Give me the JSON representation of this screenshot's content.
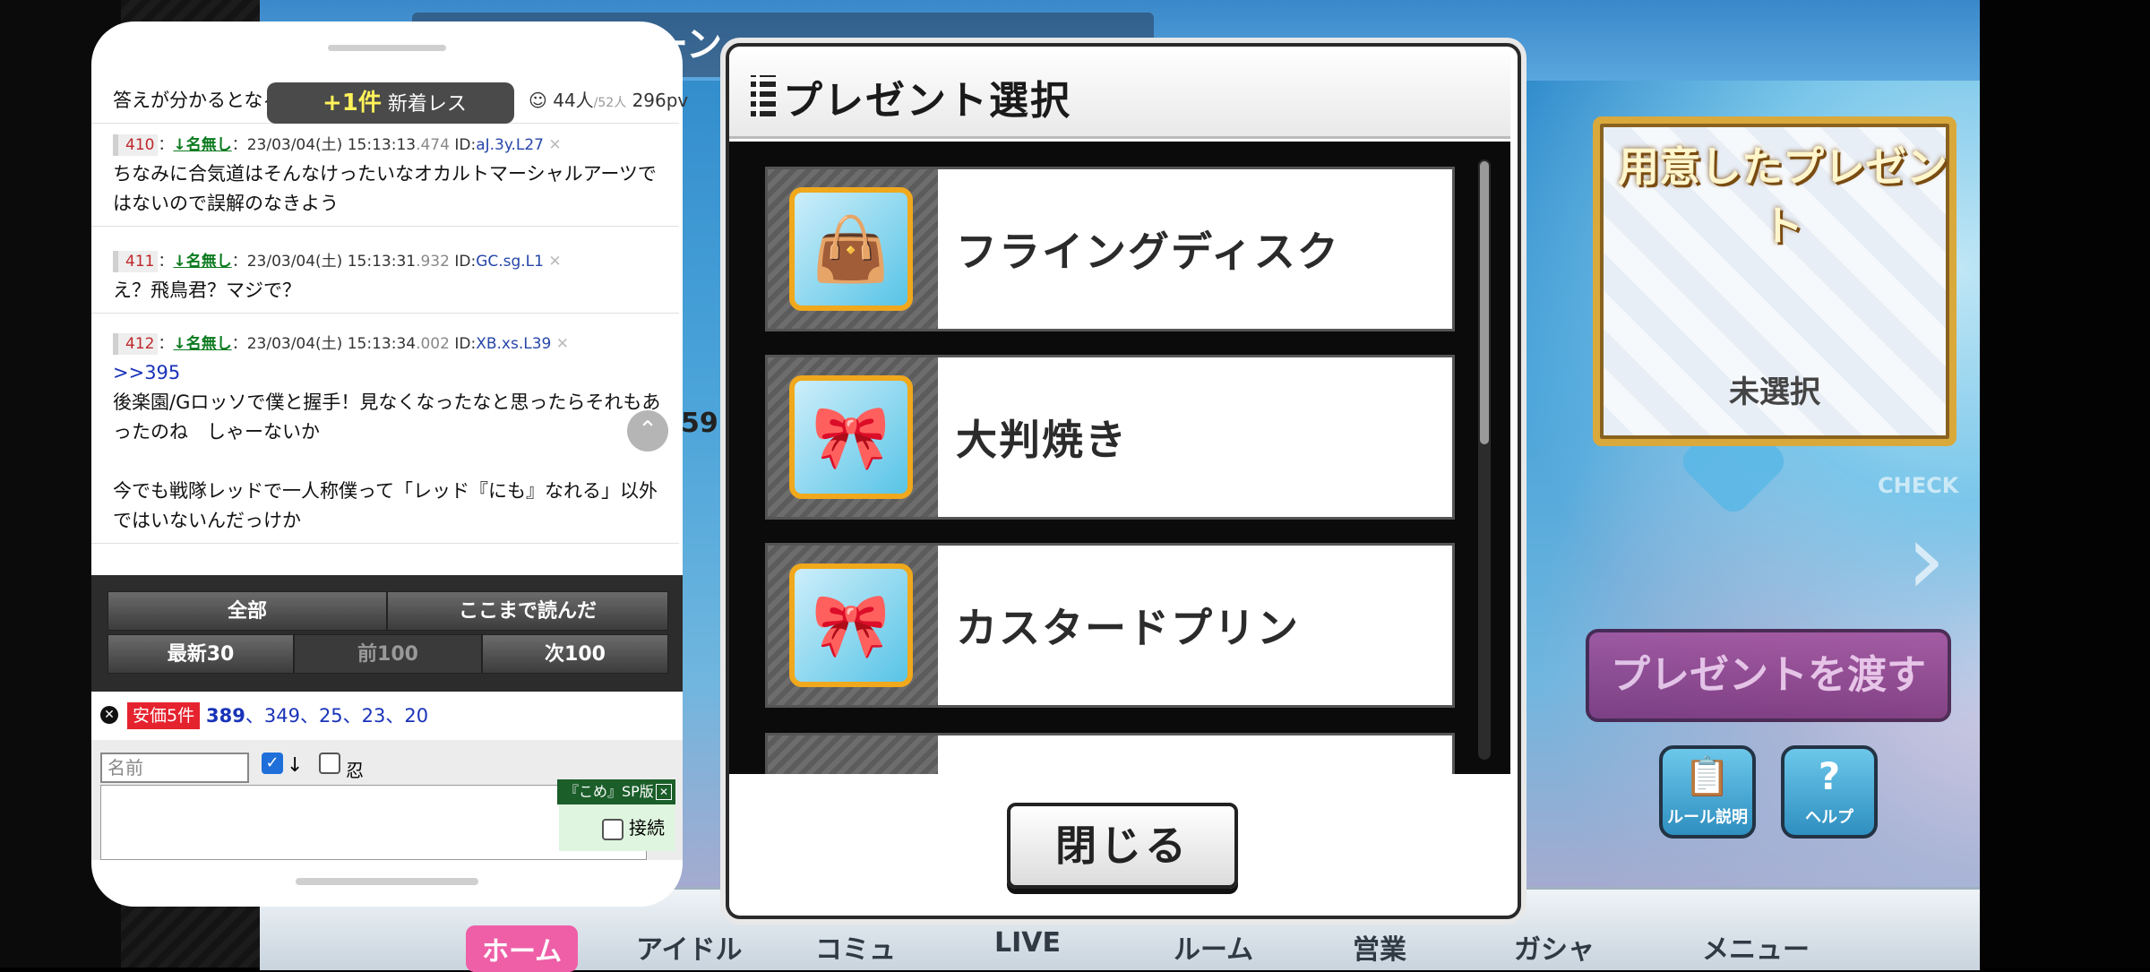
{
  "game": {
    "campaign_banner": "デーキャンペーン",
    "prepared_present_title": "用意したプレゼント",
    "unselected_label": "未選択",
    "give_present_button": "プレゼントを渡す",
    "rules_button": "ルール説明",
    "help_button": "ヘルプ",
    "check_label": "CHECK",
    "partial_number": "59",
    "bottom_nav": [
      "ホーム",
      "アイドル",
      "コミュ",
      "LIVE",
      "ルーム",
      "営業",
      "ガシャ",
      "メニュー"
    ]
  },
  "modal": {
    "title": "プレゼント選択",
    "items": [
      {
        "name": "フライングディスク",
        "icon": "bag-ribbon-icon"
      },
      {
        "name": "大判焼き",
        "icon": "bag-bow-icon"
      },
      {
        "name": "カスタードプリン",
        "icon": "bag-bow-icon"
      }
    ],
    "close_button": "閉じる"
  },
  "browser": {
    "partial_top_text": "答えが分かるとなるほど",
    "new_res": {
      "count": "+1件",
      "label": "新着レス"
    },
    "stats": {
      "users": "44人",
      "total": "/52人",
      "pv": "296pv"
    },
    "responses": [
      {
        "num": "410",
        "name": "↓名無し",
        "date": "23/03/04(土) 15:13:13",
        "ms": ".474",
        "id": "aJ.3y.L27",
        "body": "ちなみに合気道はそんなけったいなオカルトマーシャルアーツではないので誤解のなきよう"
      },
      {
        "num": "411",
        "name": "↓名無し",
        "date": "23/03/04(土) 15:13:31",
        "ms": ".932",
        "id": "GC.sg.L1",
        "body": "え？飛鳥君？マジで？"
      },
      {
        "num": "412",
        "name": "↓名無し",
        "date": "23/03/04(土) 15:13:34",
        "ms": ".002",
        "id": "XB.xs.L39",
        "anchor": ">>395",
        "body": "後楽園/Gロッソで僕と握手！見なくなったなと思ったらそれもあったのね　しゃーないか\n\n今でも戦隊レッドで一人称僕って「レッド『にも』なれる」以外ではいないんだっけか"
      }
    ],
    "buttons": {
      "all": "全部",
      "read_here": "ここまで読んだ",
      "latest30": "最新30",
      "prev100": "前100",
      "next100": "次100"
    },
    "anchor_bar": {
      "label": "安価5件",
      "links": [
        "389",
        "349",
        "25",
        "23",
        "20"
      ]
    },
    "form": {
      "name_placeholder": "名前",
      "ninja_label": "忍",
      "sp_tag": "『こめ』SP版",
      "connect_label": "接続"
    }
  }
}
